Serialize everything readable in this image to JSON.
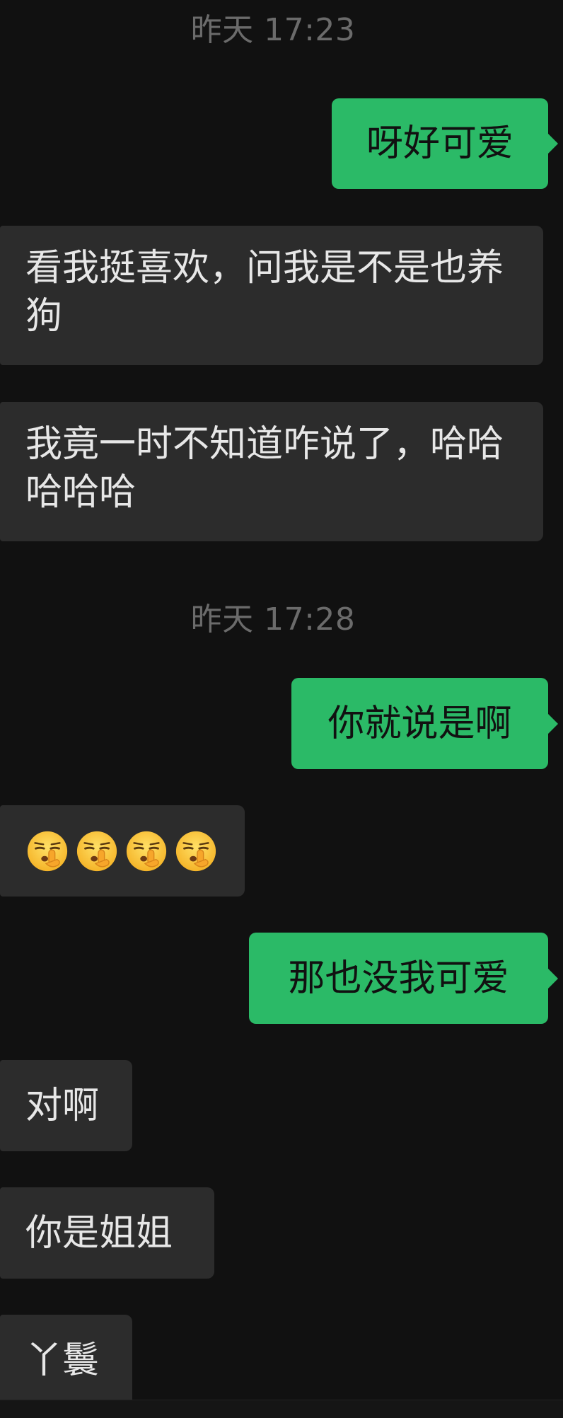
{
  "timestamps": {
    "first": "昨天 17:23",
    "second": "昨天 17:28"
  },
  "messages": [
    {
      "sender": "me",
      "text": "呀好可爱"
    },
    {
      "sender": "other",
      "text": "看我挺喜欢，问我是不是也养狗"
    },
    {
      "sender": "other",
      "text": "我竟一时不知道咋说了，哈哈哈哈哈"
    },
    {
      "sender": "me",
      "text": "你就说是啊"
    },
    {
      "sender": "other",
      "emoji": "shushing-face-icon",
      "emoji_count": 4
    },
    {
      "sender": "me",
      "text": "那也没我可爱"
    },
    {
      "sender": "other",
      "text": "对啊"
    },
    {
      "sender": "other",
      "text": "你是姐姐"
    },
    {
      "sender": "other",
      "text": "丫鬟"
    }
  ],
  "colors": {
    "background": "#111111",
    "outgoing_bubble": "#2bba67",
    "incoming_bubble": "#2c2c2c",
    "timestamp_text": "#6b6b6b",
    "incoming_text": "#e7e7e7",
    "outgoing_text": "#111111"
  }
}
